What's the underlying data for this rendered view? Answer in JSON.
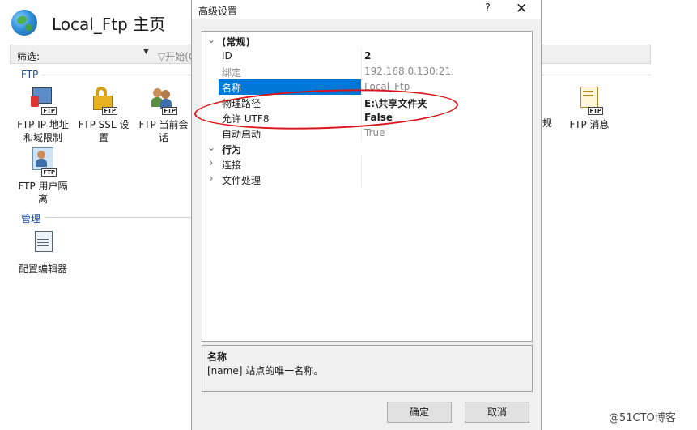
{
  "main": {
    "title": "Local_Ftp 主页",
    "filter_label": "筛选:",
    "filter_start": "开始(G",
    "group_ftp": "FTP",
    "group_manage": "管理",
    "tiles": [
      {
        "label_1": "FTP IP 地址",
        "label_2": "和域限制"
      },
      {
        "label_1": "FTP SSL 设",
        "label_2": "置"
      },
      {
        "label_1": "FTP 当前会",
        "label_2": "话"
      },
      {
        "label_1": "FTP 用户隔",
        "label_2": "离"
      }
    ],
    "tile_messages": "FTP 消息",
    "partial_label": "规",
    "tile_config": "配置编辑器"
  },
  "dialog": {
    "title": "高级设置",
    "help": "?",
    "close": "✕",
    "rows": [
      {
        "type": "category",
        "expand": "⌄",
        "key": "(常规)",
        "value": ""
      },
      {
        "type": "prop",
        "key": "ID",
        "value": "2",
        "bold": true
      },
      {
        "type": "prop",
        "key": "绑定",
        "value": "192.168.0.130:21:",
        "muted": true
      },
      {
        "type": "prop",
        "key": "名称",
        "value": "Local_Ftp",
        "selected": true,
        "muted": true
      },
      {
        "type": "prop",
        "key": "物理路径",
        "value": "E:\\共享文件夹",
        "bold": true
      },
      {
        "type": "prop",
        "key": "允许 UTF8",
        "value": "False",
        "bold": true
      },
      {
        "type": "prop",
        "key": "自动启动",
        "value": "True",
        "muted": true
      },
      {
        "type": "category",
        "expand": "⌄",
        "key": "行为",
        "value": ""
      },
      {
        "type": "sub",
        "expand": "›",
        "key": "连接",
        "value": ""
      },
      {
        "type": "sub",
        "expand": "›",
        "key": "文件处理",
        "value": ""
      }
    ],
    "desc_title": "名称",
    "desc_body": "[name] 站点的唯一名称。",
    "ok": "确定",
    "cancel": "取消"
  },
  "watermark": "@51CTO博客",
  "colors": {
    "selection": "#0078d7",
    "annotation": "#d9151b",
    "group_header": "#1e4fa0"
  }
}
